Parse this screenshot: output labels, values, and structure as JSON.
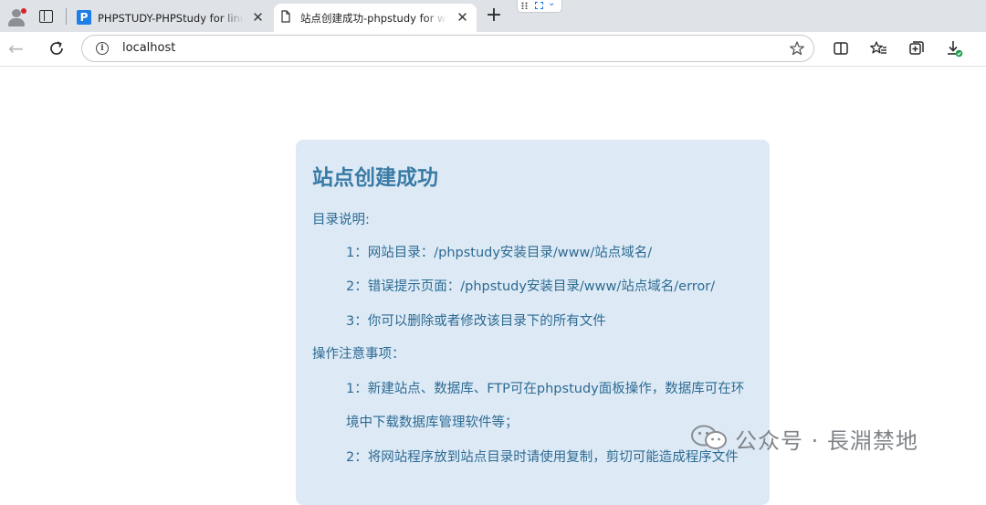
{
  "tabs": [
    {
      "title": "PHPSTUDY-PHPStudy for linux面板",
      "favicon": "phpstudy-p-icon",
      "active": false
    },
    {
      "title": "站点创建成功-phpstudy for windows",
      "favicon": "document-icon",
      "active": true
    }
  ],
  "address_bar": {
    "url": "localhost"
  },
  "card": {
    "title": "站点创建成功",
    "lines": [
      "目录说明:",
      "1：网站目录：/phpstudy安装目录/www/站点域名/",
      "2：错误提示页面：/phpstudy安装目录/www/站点域名/error/",
      "3：你可以删除或者修改该目录下的所有文件",
      "操作注意事项：",
      "1：新建站点、数据库、FTP可在phpstudy面板操作，数据库可在环",
      "境中下载数据库管理软件等；",
      "2：将网站程序放到站点目录时请使用复制，剪切可能造成程序文件"
    ]
  },
  "watermark": {
    "text": "公众号 · 長淵禁地",
    "icon": "wechat-icon"
  },
  "colors": {
    "card_bg": "#ddeaf6",
    "title": "#3a7ba6",
    "body_text": "#2d6a92",
    "tab_strip": "#dfe3e8"
  }
}
